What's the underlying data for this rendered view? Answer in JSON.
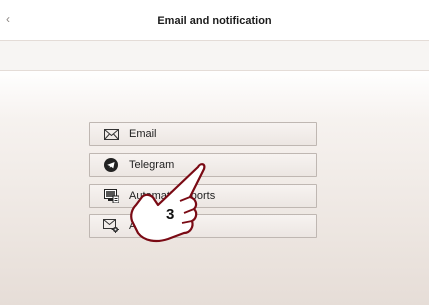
{
  "header": {
    "title": "Email and notification"
  },
  "menu": {
    "items": [
      {
        "label": "Email",
        "icon": "envelope-icon"
      },
      {
        "label": "Telegram",
        "icon": "telegram-icon"
      },
      {
        "label": "Automatic reports",
        "icon": "report-monitor-icon"
      },
      {
        "label": "Alert settings",
        "icon": "envelope-gear-icon"
      }
    ]
  },
  "overlay": {
    "step_number": "3",
    "icon": "pointing-hand-icon"
  }
}
